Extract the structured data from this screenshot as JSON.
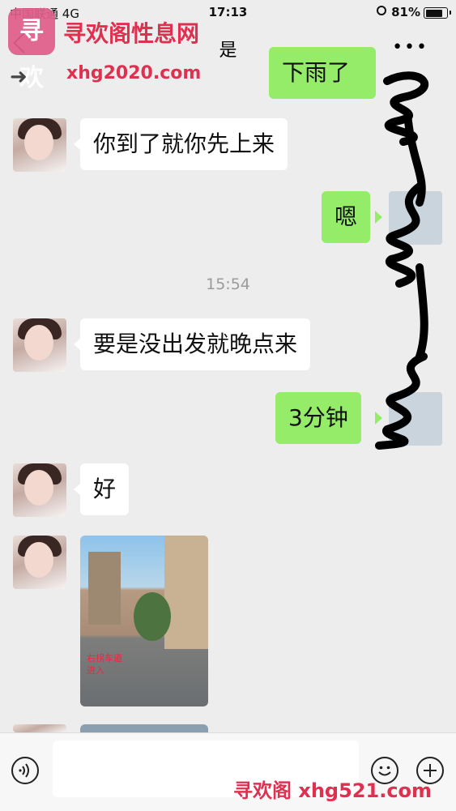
{
  "status_bar": {
    "carrier": "中国联通",
    "network": "4G",
    "time": "17:13",
    "battery": "81%"
  },
  "nav": {
    "title": "是",
    "more": "•••"
  },
  "watermark": {
    "logo_text": "寻欢",
    "site_name": "寻欢阁性息网",
    "site_url": "xhg2020.com",
    "bottom_text": "寻欢阁 xhg521.com"
  },
  "messages": [
    {
      "side": "right",
      "text": "下雨了"
    },
    {
      "side": "left",
      "text": "你到了就你先上来"
    },
    {
      "side": "right",
      "text": "嗯"
    },
    {
      "side": "left",
      "text": "要是没出发就晚点来"
    },
    {
      "side": "right",
      "text": "3分钟"
    },
    {
      "side": "left",
      "text": "好"
    }
  ],
  "timestamp": "15:54",
  "photo": {
    "note_line1": "右拐车道",
    "note_line2": "进入"
  },
  "colors": {
    "bubble_right": "#95ec69",
    "bubble_left": "#ffffff",
    "background": "#ededed",
    "watermark": "#e03050"
  }
}
